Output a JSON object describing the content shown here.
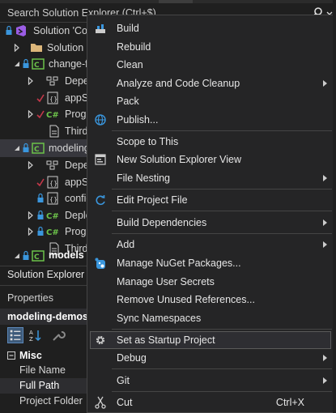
{
  "solution_explorer": {
    "search_placeholder": "Search Solution Explorer (Ctrl+$)",
    "tab_label": "Solution Explorer",
    "tree": [
      {
        "label": "Solution 'Co",
        "icon": "solution-icon",
        "bold": false
      },
      {
        "label": "Solution",
        "icon": "folder-icon",
        "bold": false
      },
      {
        "label": "change-f",
        "icon": "csharp-project-icon",
        "bold": false
      },
      {
        "label": "Depe",
        "icon": "dependencies-icon",
        "bold": false
      },
      {
        "label": "appSe",
        "icon": "json-file-icon",
        "bold": false
      },
      {
        "label": "Progr",
        "icon": "csharp-file-icon",
        "bold": false
      },
      {
        "label": "Thirdl",
        "icon": "file-icon",
        "bold": false
      },
      {
        "label": "modeling",
        "icon": "csharp-project-icon",
        "bold": false
      },
      {
        "label": "Depe",
        "icon": "dependencies-icon",
        "bold": false
      },
      {
        "label": "appSe",
        "icon": "json-file-icon",
        "bold": false
      },
      {
        "label": "config",
        "icon": "json-file-icon",
        "bold": false
      },
      {
        "label": "Deplo",
        "icon": "csharp-file-icon",
        "bold": false
      },
      {
        "label": "Progr",
        "icon": "csharp-file-icon",
        "bold": false
      },
      {
        "label": "Thirdl",
        "icon": "file-icon",
        "bold": false
      },
      {
        "label": "models",
        "icon": "csharp-project-icon",
        "bold": true
      }
    ]
  },
  "properties": {
    "title": "Properties",
    "object": "modeling-demos",
    "category": "Misc",
    "rows": [
      "File Name",
      "Full Path",
      "Project Folder"
    ]
  },
  "context_menu": {
    "items": [
      {
        "label": "Build",
        "icon": "build-icon"
      },
      {
        "label": "Rebuild"
      },
      {
        "label": "Clean"
      },
      {
        "label": "Analyze and Code Cleanup",
        "submenu": true
      },
      {
        "label": "Pack"
      },
      {
        "label": "Publish...",
        "icon": "publish-globe-icon"
      },
      {
        "label": "Scope to This"
      },
      {
        "label": "New Solution Explorer View",
        "icon": "new-view-icon"
      },
      {
        "label": "File Nesting",
        "submenu": true
      },
      {
        "label": "Edit Project File",
        "icon": "edit-project-icon"
      },
      {
        "label": "Build Dependencies",
        "submenu": true
      },
      {
        "label": "Add",
        "submenu": true
      },
      {
        "label": "Manage NuGet Packages...",
        "icon": "nuget-icon"
      },
      {
        "label": "Manage User Secrets"
      },
      {
        "label": "Remove Unused References..."
      },
      {
        "label": "Sync Namespaces"
      },
      {
        "label": "Set as Startup Project",
        "icon": "gear-icon",
        "selected": true
      },
      {
        "label": "Debug",
        "submenu": true
      },
      {
        "label": "Git",
        "submenu": true
      },
      {
        "label": "Cut",
        "icon": "scissors-icon",
        "shortcut": "Ctrl+X"
      }
    ]
  },
  "colors": {
    "background": "#1f1f1f",
    "menu_background": "#252526",
    "menu_border": "#454545",
    "csharp_green": "#6cc24a",
    "accent_blue": "#3a96dd",
    "git_red": "#c5384a"
  }
}
